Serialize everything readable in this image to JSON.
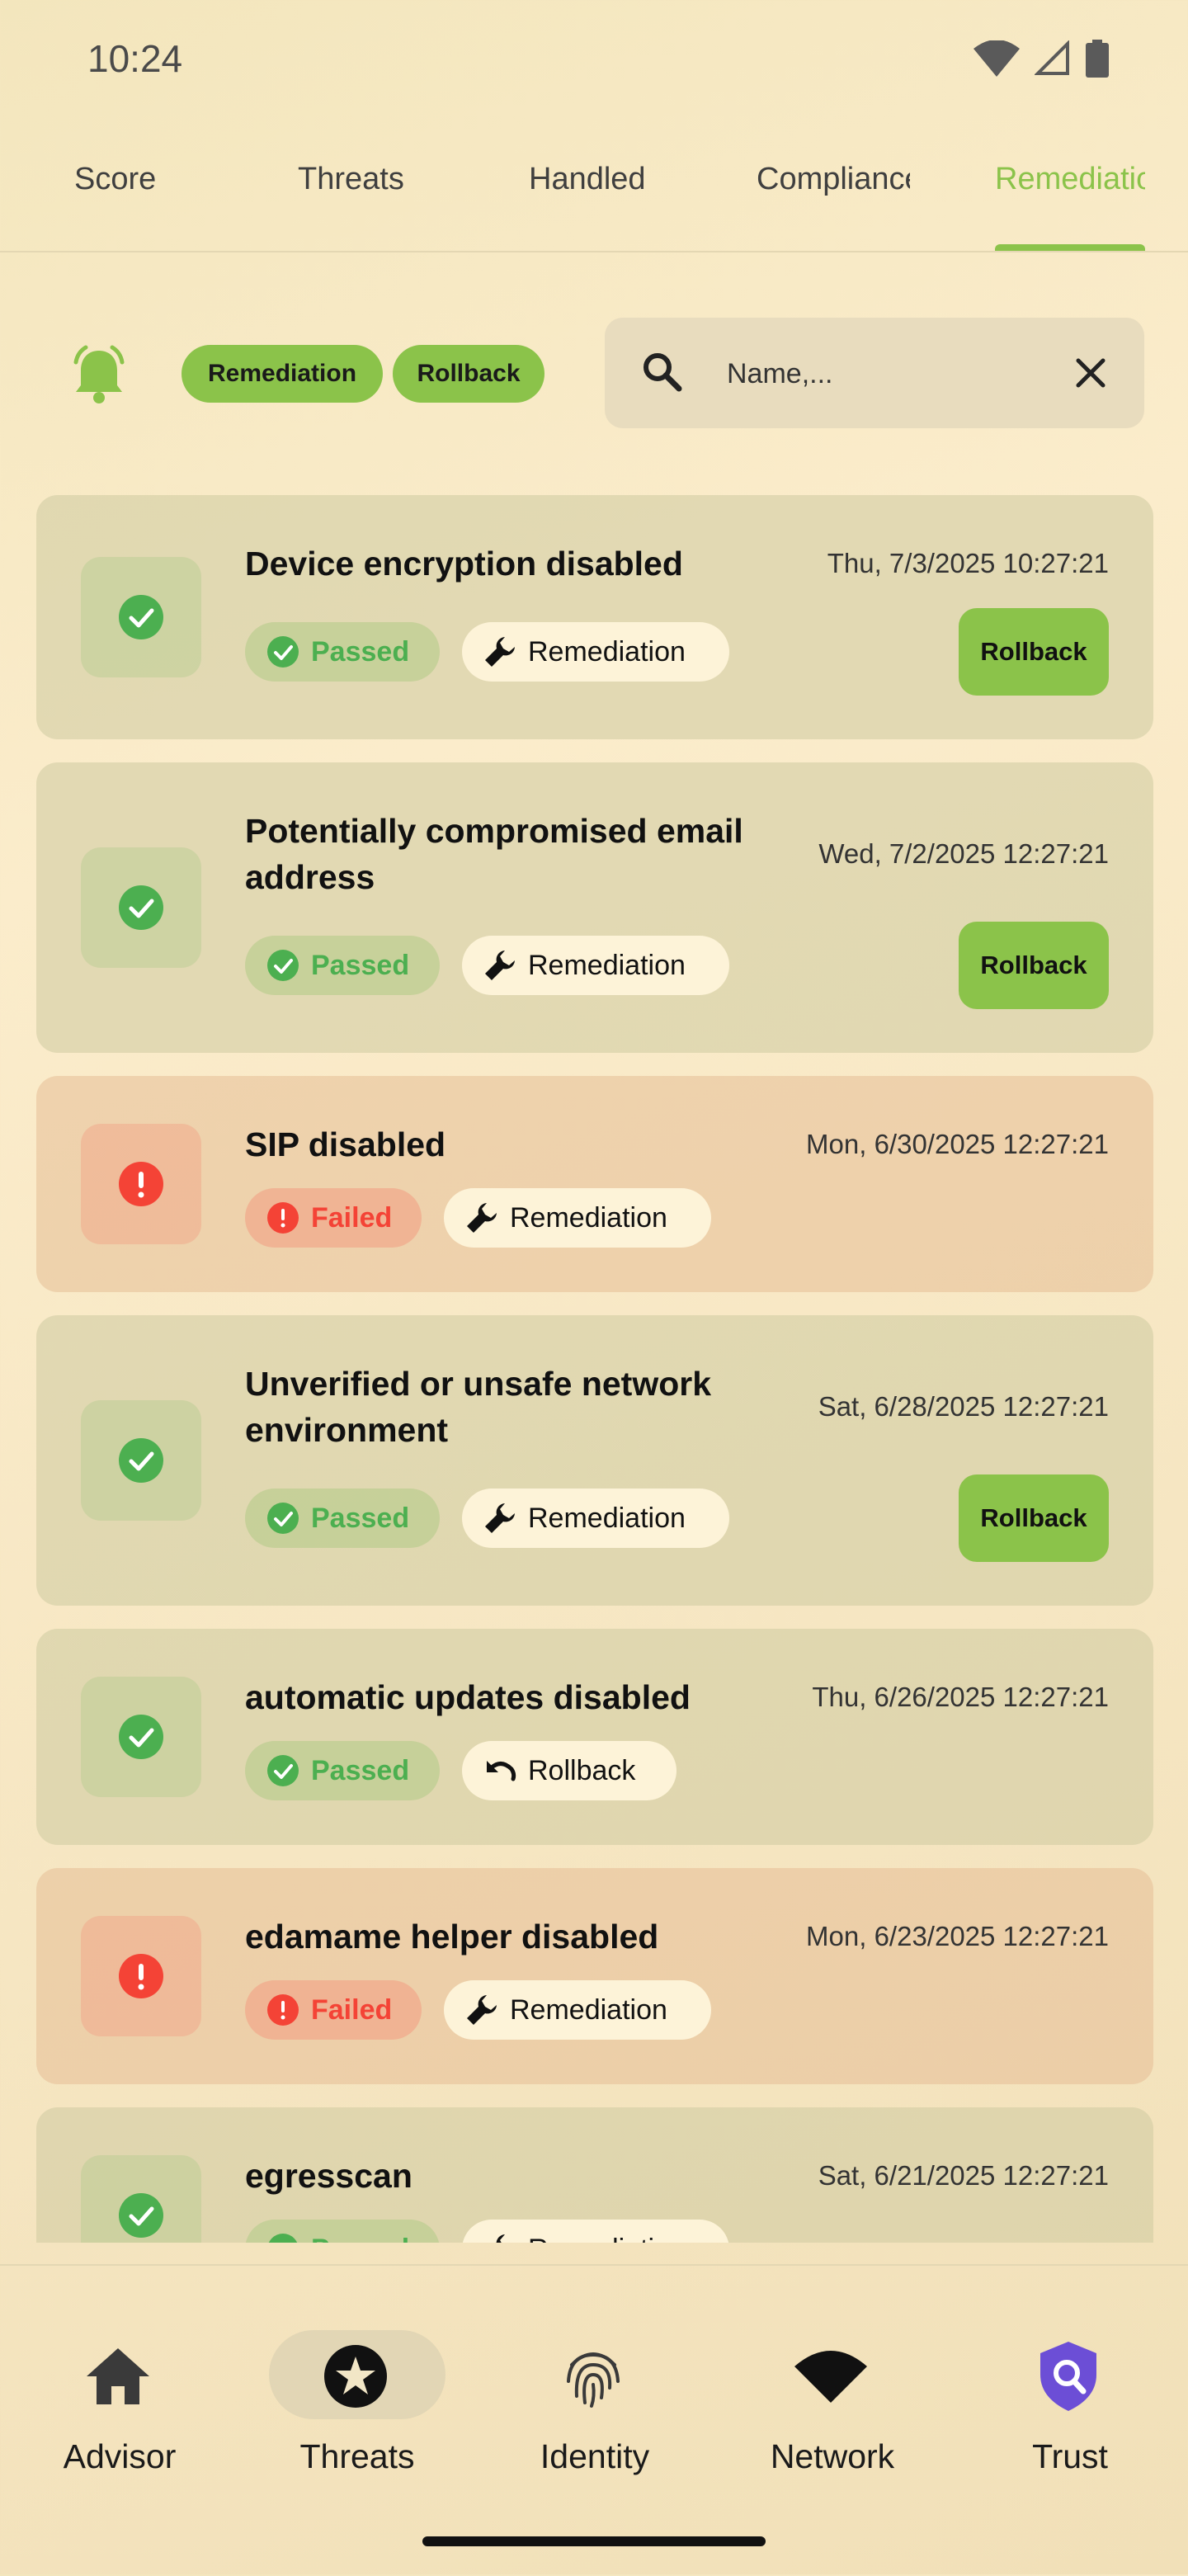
{
  "status_bar": {
    "time": "10:24"
  },
  "tabs": [
    {
      "label": "Score",
      "active": false
    },
    {
      "label": "Threats",
      "active": false
    },
    {
      "label": "Handled",
      "active": false
    },
    {
      "label": "Compliance",
      "active": false
    },
    {
      "label": "Remediation",
      "active": true
    }
  ],
  "filters": {
    "chips": [
      "Remediation",
      "Rollback"
    ],
    "search_placeholder": "Name,...",
    "search_value": ""
  },
  "colors": {
    "accent": "#8bc34a",
    "passed": "#4caf50",
    "failed": "#f44336"
  },
  "items": [
    {
      "title": "Device encryption disabled",
      "date": "Thu, 7/3/2025 10:27:21",
      "status": "Passed",
      "action": "Remediation",
      "button": "Rollback"
    },
    {
      "title": "Potentially compromised email address",
      "date": "Wed, 7/2/2025 12:27:21",
      "status": "Passed",
      "action": "Remediation",
      "button": "Rollback"
    },
    {
      "title": "SIP disabled",
      "date": "Mon, 6/30/2025 12:27:21",
      "status": "Failed",
      "action": "Remediation",
      "button": ""
    },
    {
      "title": "Unverified or unsafe network environment",
      "date": "Sat, 6/28/2025 12:27:21",
      "status": "Passed",
      "action": "Remediation",
      "button": "Rollback"
    },
    {
      "title": "automatic updates disabled",
      "date": "Thu, 6/26/2025 12:27:21",
      "status": "Passed",
      "action": "Rollback",
      "button": ""
    },
    {
      "title": "edamame helper disabled",
      "date": "Mon, 6/23/2025 12:27:21",
      "status": "Failed",
      "action": "Remediation",
      "button": ""
    },
    {
      "title": "egresscan",
      "date": "Sat, 6/21/2025 12:27:21",
      "status": "Passed",
      "action": "Remediation",
      "button": ""
    }
  ],
  "bottom_nav": [
    {
      "label": "Advisor",
      "icon": "home-icon",
      "active": false
    },
    {
      "label": "Threats",
      "icon": "star-icon",
      "active": true
    },
    {
      "label": "Identity",
      "icon": "fingerprint-icon",
      "active": false
    },
    {
      "label": "Network",
      "icon": "wifi-icon",
      "active": false
    },
    {
      "label": "Trust",
      "icon": "shield-search-icon",
      "active": false
    }
  ]
}
